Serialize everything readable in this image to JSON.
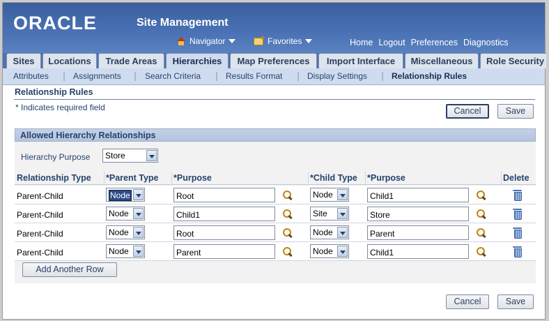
{
  "header": {
    "logo": "ORACLE",
    "app_title": "Site Management",
    "navigator": "Navigator",
    "favorites": "Favorites",
    "links": [
      "Home",
      "Logout",
      "Preferences",
      "Diagnostics"
    ]
  },
  "tabs": [
    {
      "label": "Sites",
      "active": false
    },
    {
      "label": "Locations",
      "active": false
    },
    {
      "label": "Trade Areas",
      "active": false
    },
    {
      "label": "Hierarchies",
      "active": true
    },
    {
      "label": "Map Preferences",
      "active": false
    },
    {
      "label": "Import Interface",
      "active": false
    },
    {
      "label": "Miscellaneous",
      "active": false
    },
    {
      "label": "Role Security",
      "active": false
    }
  ],
  "subtabs": [
    {
      "label": "Attributes",
      "active": false
    },
    {
      "label": "Assignments",
      "active": false
    },
    {
      "label": "Search Criteria",
      "active": false
    },
    {
      "label": "Results Format",
      "active": false
    },
    {
      "label": "Display Settings",
      "active": false
    },
    {
      "label": "Relationship Rules",
      "active": true
    }
  ],
  "page": {
    "title": "Relationship Rules",
    "required_note": "* Indicates required field",
    "cancel": "Cancel",
    "save": "Save"
  },
  "region": {
    "title": "Allowed Hierarchy Relationships",
    "hierarchy_purpose_label": "Hierarchy Purpose",
    "hierarchy_purpose_value": "Store",
    "columns": [
      "Relationship Type",
      "*Parent Type",
      "*Purpose",
      "*Child Type",
      "*Purpose",
      "Delete"
    ],
    "rows": [
      {
        "relationship_type": "Parent-Child",
        "parent_type": "Node",
        "parent_purpose": "Root",
        "child_type": "Node",
        "child_purpose": "Child1"
      },
      {
        "relationship_type": "Parent-Child",
        "parent_type": "Node",
        "parent_purpose": "Child1",
        "child_type": "Site",
        "child_purpose": "Store"
      },
      {
        "relationship_type": "Parent-Child",
        "parent_type": "Node",
        "parent_purpose": "Root",
        "child_type": "Node",
        "child_purpose": "Parent"
      },
      {
        "relationship_type": "Parent-Child",
        "parent_type": "Node",
        "parent_purpose": "Parent",
        "child_type": "Node",
        "child_purpose": "Child1"
      }
    ],
    "add_row": "Add Another Row"
  },
  "colors": {
    "brand_blue": "#4a72b4",
    "label_blue": "#26426c",
    "subtab_bg": "#cfdcef"
  }
}
